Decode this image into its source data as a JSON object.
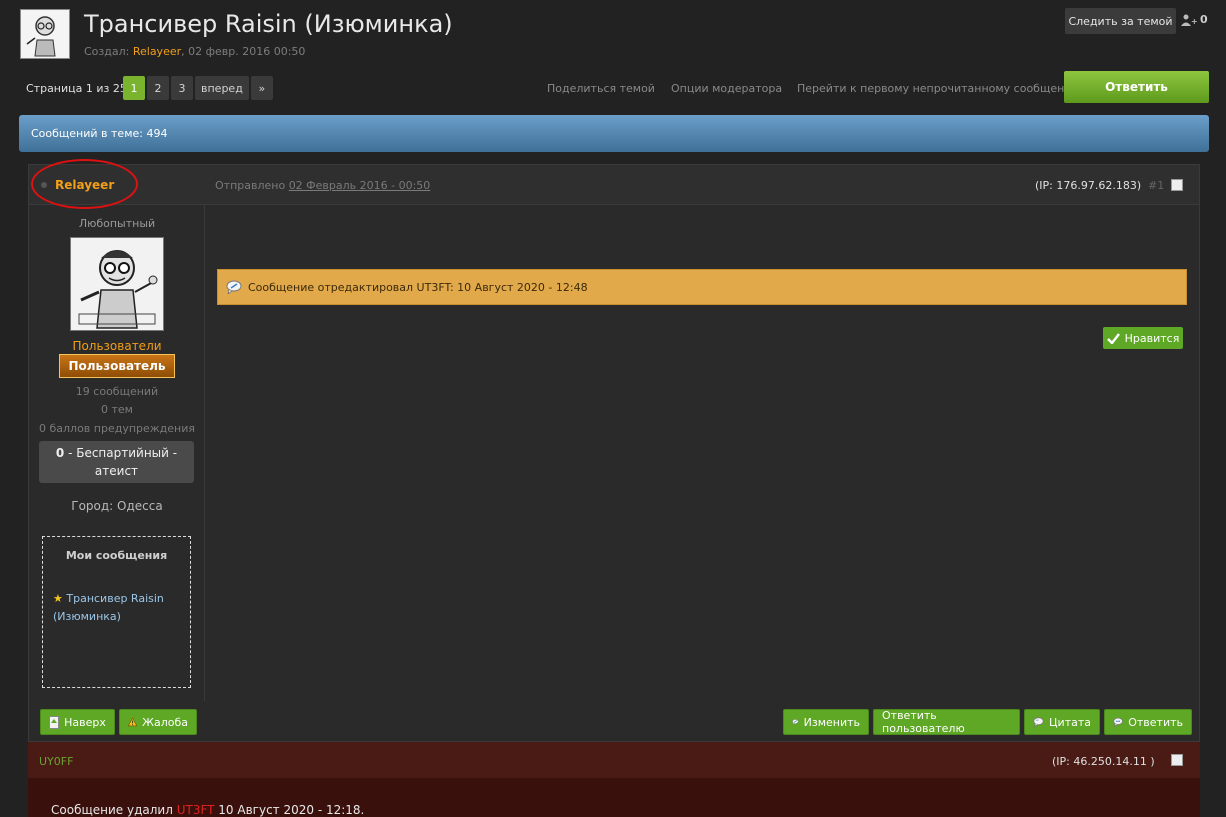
{
  "topic": {
    "title": "Трансивер Raisin (Изюминка)",
    "meta_prefix": "Создал: ",
    "author": "Relayeer",
    "meta_date": ", 02 февр. 2016 00:50",
    "follow_label": "Следить за темой",
    "followers_count": "0"
  },
  "pagination": {
    "label": "Страница 1 из 25",
    "pages": [
      "1",
      "2",
      "3"
    ],
    "next_label": "вперед",
    "last_label": "»"
  },
  "toolbar": {
    "share": "Поделиться темой",
    "moderator": "Опции модератора",
    "first_unread": "Перейти к первому непрочитанному сообщению",
    "reply": "Ответить"
  },
  "count_bar": "Сообщений в теме: 494",
  "post": {
    "author": "Relayeer",
    "posted_prefix": "Отправлено ",
    "posted_date": "02 Февраль 2016 - 00:50",
    "ip": "(IP: 176.97.62.183)",
    "number": "#1",
    "rank": "Любопытный",
    "group": "Пользователи",
    "group_badge": "Пользователь",
    "stats": [
      "19 сообщений",
      "0 тем",
      "0 баллов предупреждения"
    ],
    "rep_value": "0",
    "rep_text_1": " - Беспартийный -",
    "rep_text_2": "атеист",
    "city": "Город: Одесса",
    "my_posts_title": "Мои сообщения",
    "my_posts_item": "Трансивер Raisin (Изюминка)",
    "edit_note": "Сообщение отредактировал UT3FT: 10 Август 2020 - 12:48",
    "like_label": "Нравится",
    "buttons": {
      "top": "Наверх",
      "report": "Жалоба",
      "edit": "Изменить",
      "reply_user": "Ответить пользователю",
      "quote": "Цитата",
      "reply": "Ответить"
    }
  },
  "deleted_post": {
    "author": "UY0FF",
    "ip": "(IP: 46.250.14.11 )",
    "msg_prefix": "Сообщение удалил ",
    "moderator": "UT3FT",
    "msg_suffix": " 10 Август 2020 - 12:18."
  },
  "colors": {
    "accent_green": "#5ea825",
    "author_orange": "#f29f1a",
    "count_bar_blue": "#5588b2",
    "edit_note_bg": "#e2a94a",
    "deleted_bg": "#4a1a14"
  }
}
